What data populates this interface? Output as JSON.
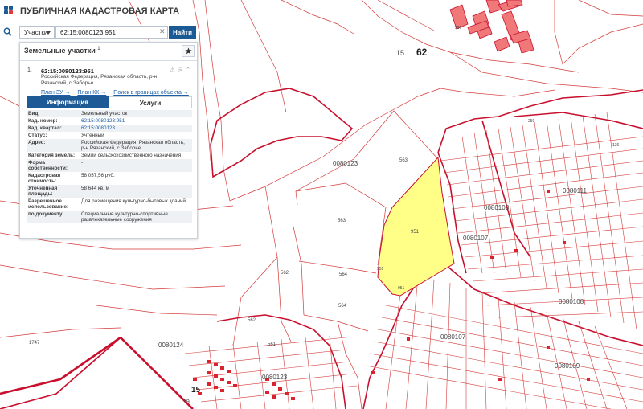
{
  "header": {
    "title": "ПУБЛИЧНАЯ КАДАСТРОВАЯ КАРТА"
  },
  "search": {
    "type_value": "Участки",
    "query": "62:15:0080123:951",
    "button_label": "Найти"
  },
  "panel": {
    "title": "Земельные участки",
    "title_count": "1",
    "item": {
      "index": "1.",
      "number": "62:15:0080123:951",
      "address": "Российская Федерация, Рязанская область, р-н Рязанский, с.Заборье",
      "links": [
        "План ЗУ →",
        "План КК →",
        "Поиск в границах объекта →"
      ]
    },
    "tabs": [
      "Информация",
      "Услуги"
    ],
    "attributes": [
      {
        "key": "Вид:",
        "value": "Земельный участок"
      },
      {
        "key": "Кад. номер:",
        "value": "62:15:0080123:951"
      },
      {
        "key": "Кад. квартал:",
        "value": "62:15:0080123"
      },
      {
        "key": "Статус:",
        "value": "Учтенный"
      },
      {
        "key": "Адрес:",
        "value": "Российская Федерация, Рязанская область, р-н Рязанский, с.Заборье"
      },
      {
        "key": "Категория земель:",
        "value": "Земли сельскохозяйственного назначения"
      },
      {
        "key": "Форма собственности:",
        "value": "-"
      },
      {
        "key": "Кадастровая стоимость:",
        "value": "58 057,56 руб."
      },
      {
        "key": "Уточненная площадь:",
        "value": "58 644 кв. м"
      },
      {
        "key": "Разрешенное использование:",
        "value": "Для размещения культурно-бытовых зданий"
      },
      {
        "key": "по документу:",
        "value": "Специальные культурно-спортивные развлекательные сооружения"
      }
    ]
  },
  "map": {
    "accent_color": "#c8102e",
    "selected_fill": "#ffff88",
    "block_labels": [
      "0080123",
      "0080111",
      "0080108",
      "0080107",
      "0080108",
      "0080107",
      "0080109",
      "0080124",
      "0080123"
    ],
    "parcel_labels": [
      "563",
      "563",
      "951",
      "951",
      "951",
      "564",
      "564",
      "562",
      "562",
      "561",
      "1747",
      "15",
      "62",
      "19",
      "15",
      "906",
      "259",
      "136"
    ]
  }
}
